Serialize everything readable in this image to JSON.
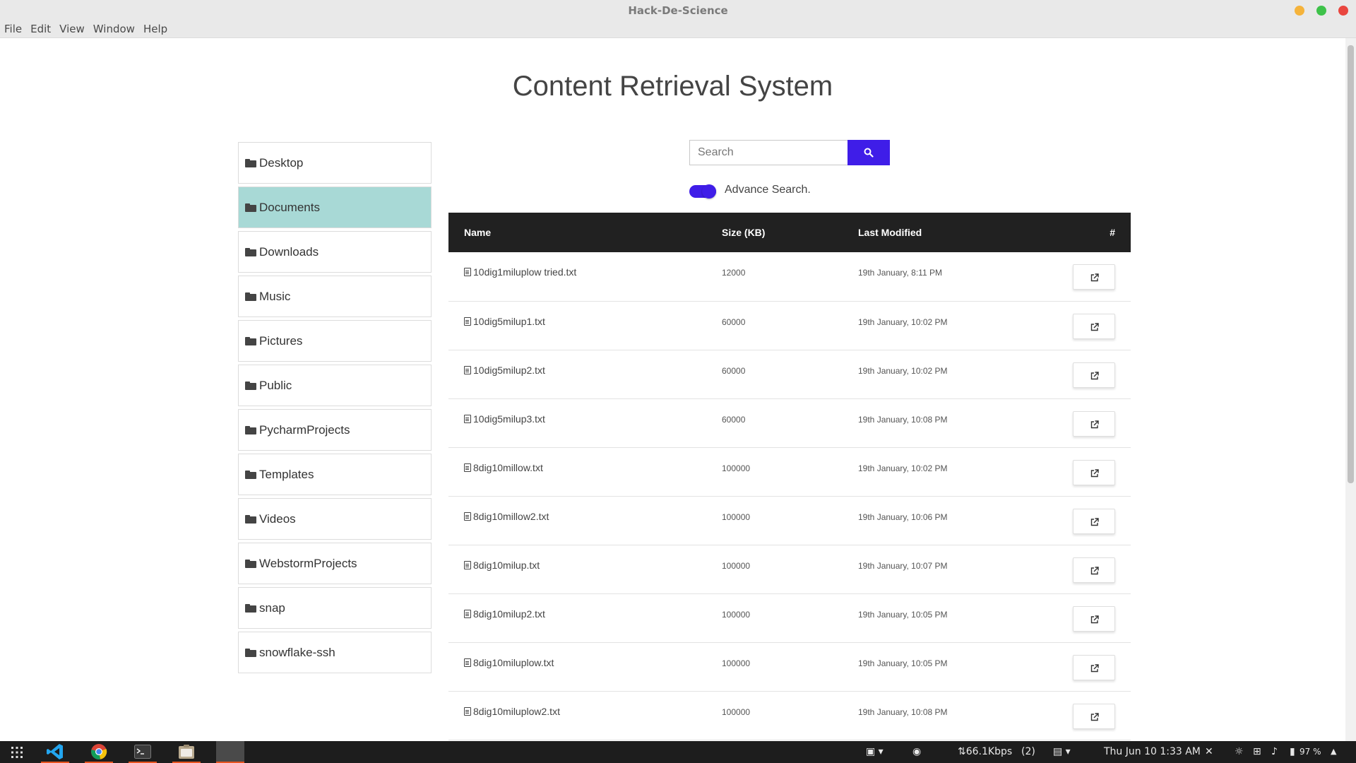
{
  "window": {
    "title": "Hack-De-Science",
    "menu": [
      "File",
      "Edit",
      "View",
      "Window",
      "Help"
    ]
  },
  "page": {
    "title": "Content Retrieval System"
  },
  "sidebar": {
    "items": [
      {
        "label": "Desktop",
        "active": false
      },
      {
        "label": "Documents",
        "active": true
      },
      {
        "label": "Downloads",
        "active": false
      },
      {
        "label": "Music",
        "active": false
      },
      {
        "label": "Pictures",
        "active": false
      },
      {
        "label": "Public",
        "active": false
      },
      {
        "label": "PycharmProjects",
        "active": false
      },
      {
        "label": "Templates",
        "active": false
      },
      {
        "label": "Videos",
        "active": false
      },
      {
        "label": "WebstormProjects",
        "active": false
      },
      {
        "label": "snap",
        "active": false
      },
      {
        "label": "snowflake-ssh",
        "active": false
      }
    ]
  },
  "search": {
    "placeholder": "Search",
    "value": "",
    "button_icon": "search-icon"
  },
  "advanced": {
    "label": "Advance Search.",
    "enabled": true
  },
  "table": {
    "headers": {
      "name": "Name",
      "size": "Size (KB)",
      "modified": "Last Modified",
      "action": "#"
    },
    "rows": [
      {
        "name": "10dig1miluplow tried.txt",
        "size": "12000",
        "modified": "19th January, 8:11 PM"
      },
      {
        "name": "10dig5milup1.txt",
        "size": "60000",
        "modified": "19th January, 10:02 PM"
      },
      {
        "name": "10dig5milup2.txt",
        "size": "60000",
        "modified": "19th January, 10:02 PM"
      },
      {
        "name": "10dig5milup3.txt",
        "size": "60000",
        "modified": "19th January, 10:08 PM"
      },
      {
        "name": "8dig10millow.txt",
        "size": "100000",
        "modified": "19th January, 10:02 PM"
      },
      {
        "name": "8dig10millow2.txt",
        "size": "100000",
        "modified": "19th January, 10:06 PM"
      },
      {
        "name": "8dig10milup.txt",
        "size": "100000",
        "modified": "19th January, 10:07 PM"
      },
      {
        "name": "8dig10milup2.txt",
        "size": "100000",
        "modified": "19th January, 10:05 PM"
      },
      {
        "name": "8dig10miluplow.txt",
        "size": "100000",
        "modified": "19th January, 10:05 PM"
      },
      {
        "name": "8dig10miluplow2.txt",
        "size": "100000",
        "modified": "19th January, 10:08 PM"
      }
    ]
  },
  "colors": {
    "accent": "#3f1de8",
    "active_folder": "#a8d9d6",
    "table_header": "#212121"
  },
  "taskbar": {
    "apps": [
      "apps-grid-icon",
      "vscode-icon",
      "chrome-icon",
      "terminal-icon",
      "files-icon",
      "active-window"
    ],
    "network": "⇅66.1Kbps",
    "network_count": "(2)",
    "clock": "Thu Jun 10  1:33 AM",
    "battery": "97 %"
  }
}
